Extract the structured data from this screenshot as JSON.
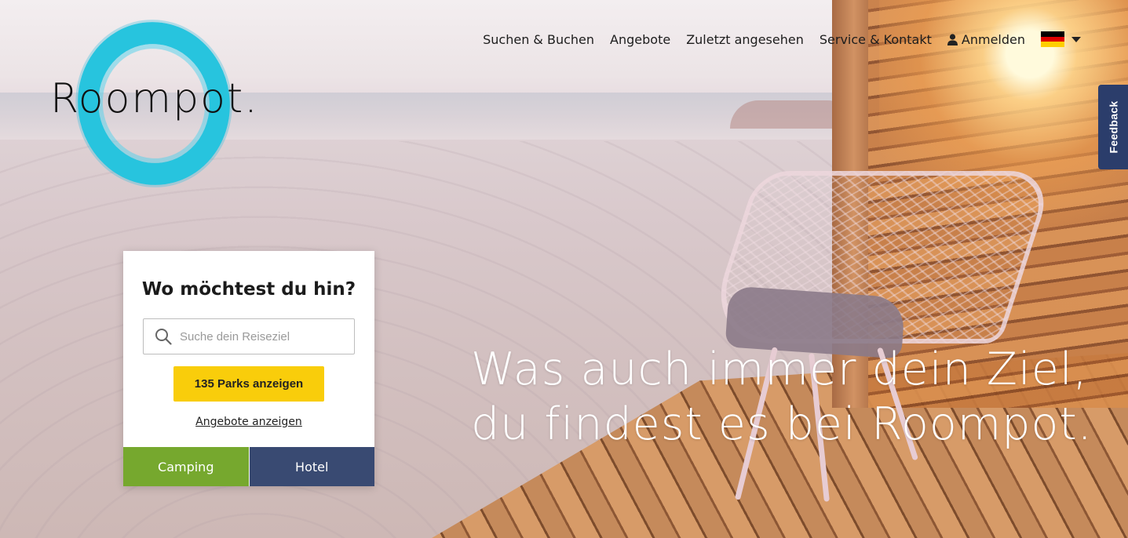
{
  "logo": {
    "text": "Roompot."
  },
  "nav": {
    "items": [
      "Suchen & Buchen",
      "Angebote",
      "Zuletzt angesehen",
      "Service & Kontakt"
    ],
    "login_label": "Anmelden",
    "language": "de"
  },
  "feedback": {
    "label": "Feedback"
  },
  "search_card": {
    "title": "Wo möchtest du hin?",
    "search_placeholder": "Suche dein Reiseziel",
    "search_value": "",
    "parks_button_label": "135 Parks anzeigen",
    "offers_link_label": "Angebote anzeigen",
    "tabs": [
      {
        "label": "Camping"
      },
      {
        "label": "Hotel"
      }
    ]
  },
  "hero": {
    "headline_line1": "Was auch immer dein Ziel,",
    "headline_line2": "du findest es bei Roompot."
  },
  "colors": {
    "logo_ring": "#27c4de",
    "primary_button": "#f9cd0b",
    "camping_tab": "#76a82e",
    "hotel_tab": "#394a72",
    "feedback_tab": "#2b3d6b"
  },
  "icons": [
    "user-icon",
    "germany-flag-icon",
    "chevron-down-icon",
    "search-icon"
  ]
}
